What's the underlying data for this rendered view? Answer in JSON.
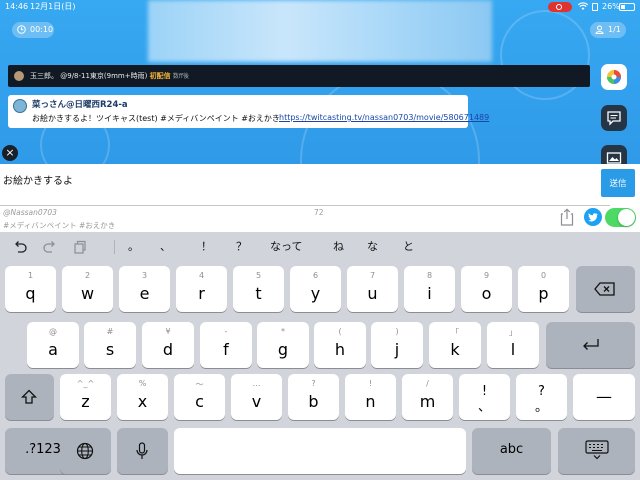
{
  "status_bar": {
    "time": "14:46",
    "date": "12月1日(日)",
    "battery": "26%"
  },
  "broadcast": {
    "timer": "00:10",
    "viewers": "1/1",
    "comment_strip": {
      "user": "玉三郎。",
      "text": "@9/8-11東京(9mm+時雨)",
      "badge": "初配信",
      "tail": "数ff後"
    },
    "bubble": {
      "name": "菜っさん@日曜西R24-a",
      "message": "お絵かきするよ！ツイキャス(test) #メディバンペイント #おえかき",
      "url": "https://twitcasting.tv/nassan0703/movie/580671489"
    }
  },
  "composer": {
    "input_value": "お絵かきするよ",
    "send_label": "送信",
    "handle": "@Nassan0703",
    "char_count": "72",
    "hashtags": "#メディバンペイント #おえかき",
    "tweet_enabled": true
  },
  "keyboard": {
    "suggestions": [
      "。",
      "、",
      "！",
      "？",
      "なって",
      "ね",
      "な",
      "と"
    ],
    "rows": [
      [
        [
          "1",
          "q"
        ],
        [
          "2",
          "w"
        ],
        [
          "3",
          "e"
        ],
        [
          "4",
          "r"
        ],
        [
          "5",
          "t"
        ],
        [
          "6",
          "y"
        ],
        [
          "7",
          "u"
        ],
        [
          "8",
          "i"
        ],
        [
          "9",
          "o"
        ],
        [
          "0",
          "p"
        ]
      ],
      [
        [
          "@",
          "a"
        ],
        [
          "#",
          "s"
        ],
        [
          "¥",
          "d"
        ],
        [
          "-",
          "f"
        ],
        [
          "*",
          "g"
        ],
        [
          "(",
          "h"
        ],
        [
          ")",
          "j"
        ],
        [
          "「",
          "k"
        ],
        [
          "」",
          "l"
        ]
      ],
      [
        [
          "^_^",
          "z"
        ],
        [
          "%",
          "x"
        ],
        [
          "〜",
          "c"
        ],
        [
          "…",
          "v"
        ],
        [
          "?",
          "b"
        ],
        [
          "!",
          "n"
        ],
        [
          "/",
          "m"
        ],
        [
          "!",
          "、"
        ],
        [
          "?",
          "。"
        ]
      ]
    ],
    "numbers_label": ".?123",
    "abc_label": "abc",
    "dash_label": "—"
  },
  "colors": {
    "stage_blue": "#37a8f2",
    "send_blue": "#2a9be6",
    "toggle_green": "#4cd964",
    "twitter_blue": "#1da1f2"
  }
}
